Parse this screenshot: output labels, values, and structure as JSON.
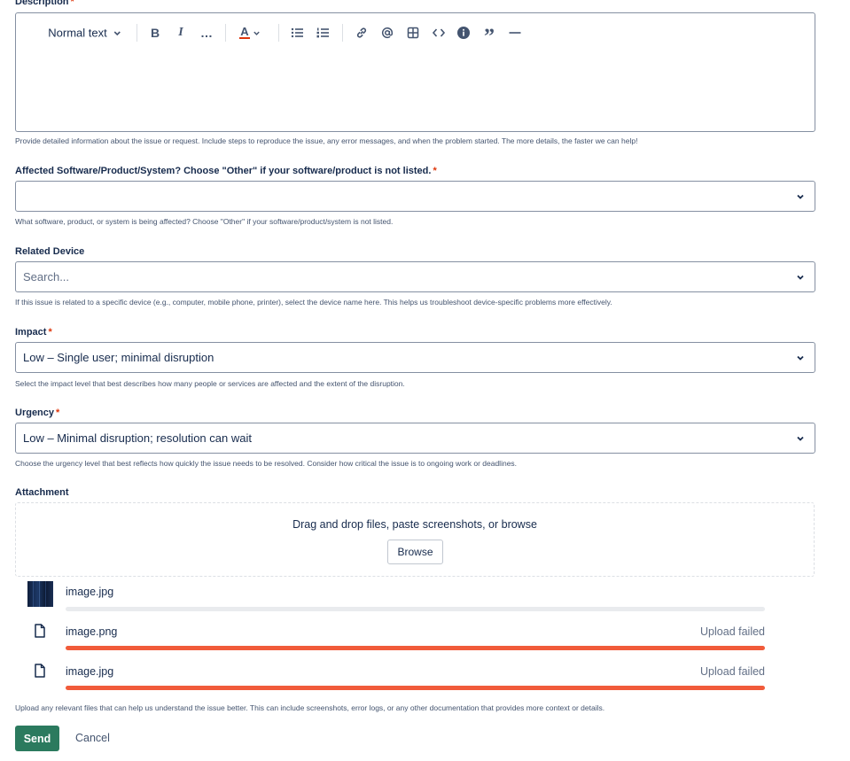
{
  "description": {
    "label": "Description",
    "required_mark": "*",
    "toolbar": {
      "text_style": "Normal text",
      "bold": "B",
      "italic": "I",
      "more": "…",
      "color": "A",
      "quote": "”"
    },
    "help": "Provide detailed information about the issue or request. Include steps to reproduce the issue, any error messages, and when the problem started. The more details, the faster we can help!"
  },
  "affected": {
    "label": "Affected Software/Product/System? Choose \"Other\" if your software/product is not listed.",
    "required_mark": "*",
    "value": "",
    "help": "What software, product, or system is being affected? Choose \"Other\" if your software/product/system is not listed."
  },
  "related_device": {
    "label": "Related Device",
    "placeholder": "Search...",
    "help": "If this issue is related to a specific device (e.g., computer, mobile phone, printer), select the device name here. This helps us troubleshoot device-specific problems more effectively."
  },
  "impact": {
    "label": "Impact",
    "required_mark": "*",
    "value": "Low – Single user; minimal disruption",
    "help": "Select the impact level that best describes how many people or services are affected and the extent of the disruption."
  },
  "urgency": {
    "label": "Urgency",
    "required_mark": "*",
    "value": "Low – Minimal disruption; resolution can wait",
    "help": "Choose the urgency level that best reflects how quickly the issue needs to be resolved. Consider how critical the issue is to ongoing work or deadlines."
  },
  "attachment": {
    "label": "Attachment",
    "drop_text": "Drag and drop files, paste screenshots, or browse",
    "browse_label": "Browse",
    "files": [
      {
        "name": "image.jpg",
        "status": "",
        "progress": 0
      },
      {
        "name": "image.png",
        "status": "Upload failed",
        "progress": 1
      },
      {
        "name": "image.jpg",
        "status": "Upload failed",
        "progress": 1
      }
    ],
    "help": "Upload any relevant files that can help us understand the issue better. This can include screenshots, error logs, or any other documentation that provides more context or details."
  },
  "actions": {
    "send_label": "Send",
    "cancel_label": "Cancel"
  },
  "colors": {
    "required": "#de350b",
    "failed_bar": "#f15b3a",
    "pending_bar": "#e9ebee",
    "send": "#2b7a5e"
  }
}
